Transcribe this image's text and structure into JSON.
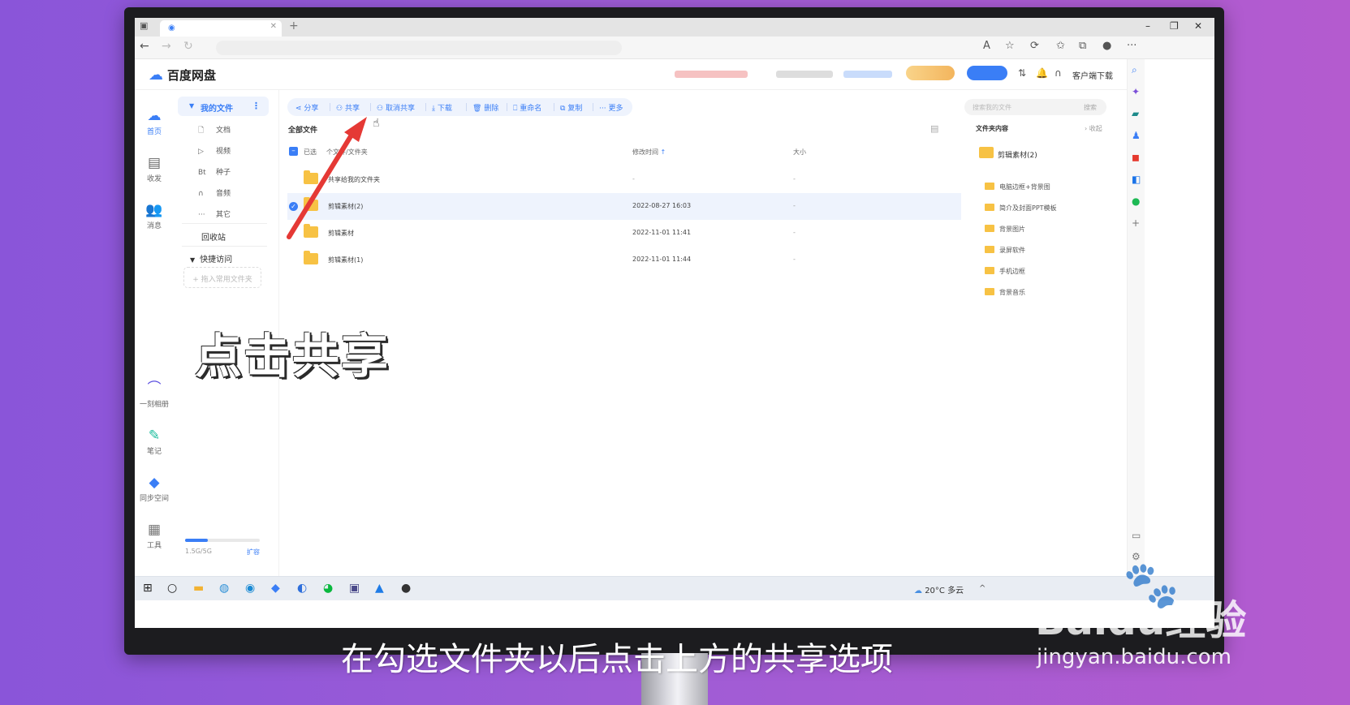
{
  "app": {
    "name": "百度网盘",
    "client_download": "客户端下载"
  },
  "rail": [
    {
      "label": "首页",
      "icon": "cloud-icon",
      "color": "#3a7ef6"
    },
    {
      "label": "收发",
      "icon": "inbox-icon",
      "color": "#555555"
    },
    {
      "label": "消息",
      "icon": "users-icon",
      "color": "#555555"
    },
    {
      "label": "一刻相册",
      "icon": "album-icon",
      "color": "#5b4fe0"
    },
    {
      "label": "笔记",
      "icon": "note-icon",
      "color": "#1abc9c"
    },
    {
      "label": "同步空间",
      "icon": "sync-icon",
      "color": "#3a7ef6"
    },
    {
      "label": "工具",
      "icon": "grid-icon",
      "color": "#555555"
    }
  ],
  "sidebar": {
    "my_files": "我的文件",
    "sub_items": [
      {
        "label": "文档",
        "icon": "doc-icon",
        "glyph": "🗋"
      },
      {
        "label": "视频",
        "icon": "play-icon",
        "glyph": "▷"
      },
      {
        "label": "种子",
        "icon": "bt-icon",
        "glyph": "Bt"
      },
      {
        "label": "音频",
        "icon": "headphones-icon",
        "glyph": "∩"
      },
      {
        "label": "其它",
        "icon": "more-icon",
        "glyph": "···"
      }
    ],
    "recycle_bin": "回收站",
    "quick_access": "快捷访问",
    "quick_placeholder": "+ 拖入常用文件夹",
    "storage": {
      "used_text": "1.5G/5G",
      "used_fraction": 0.3,
      "expand": "扩容"
    }
  },
  "toolbar": [
    {
      "label": "分享",
      "icon": "share-icon",
      "glyph": "⋖"
    },
    {
      "label": "共享",
      "icon": "cooperate-icon",
      "glyph": "⚇"
    },
    {
      "label": "取消共享",
      "icon": "uncooperate-icon",
      "glyph": "⚇"
    },
    {
      "label": "下载",
      "icon": "download-icon",
      "glyph": "⤓"
    },
    {
      "label": "删除",
      "icon": "trash-icon",
      "glyph": "🗑"
    },
    {
      "label": "重命名",
      "icon": "rename-icon",
      "glyph": "⎕"
    },
    {
      "label": "复制",
      "icon": "copy-icon",
      "glyph": "⧉"
    },
    {
      "label": "更多",
      "icon": "ellipsis-icon",
      "glyph": "···"
    }
  ],
  "main": {
    "breadcrumb": "全部文件",
    "selected_text": "已选",
    "columns": {
      "name": "个文件/文件夹",
      "modified": "修改时间",
      "size": "大小"
    },
    "rows": [
      {
        "name": "共享给我的文件夹",
        "modified": "-",
        "size": "-",
        "selected": false
      },
      {
        "name": "剪辑素材(2)",
        "modified": "2022-08-27 16:03",
        "size": "-",
        "selected": true
      },
      {
        "name": "剪辑素材",
        "modified": "2022-11-01 11:41",
        "size": "-",
        "selected": false
      },
      {
        "name": "剪辑素材(1)",
        "modified": "2022-11-01 11:44",
        "size": "-",
        "selected": false
      }
    ]
  },
  "right_panel": {
    "search_placeholder": "搜索我的文件",
    "search_button": "搜索",
    "title": "文件夹内容",
    "collapse": "收起",
    "current_folder": "剪辑素材(2)",
    "items": [
      "电脑边框+背景图",
      "简介及封面PPT模板",
      "背景图片",
      "录屏软件",
      "手机边框",
      "背景音乐"
    ]
  },
  "taskbar": {
    "weather": "20°C 多云"
  },
  "overlay": {
    "label": "点击共享",
    "caption": "在勾选文件夹以后点击上方的共享选项",
    "watermark_brand": "Baidu经验",
    "watermark_url": "jingyan.baidu.com"
  },
  "colors": {
    "accent": "#3a7ef6",
    "folder": "#f7c244",
    "arrow": "#e53935"
  }
}
